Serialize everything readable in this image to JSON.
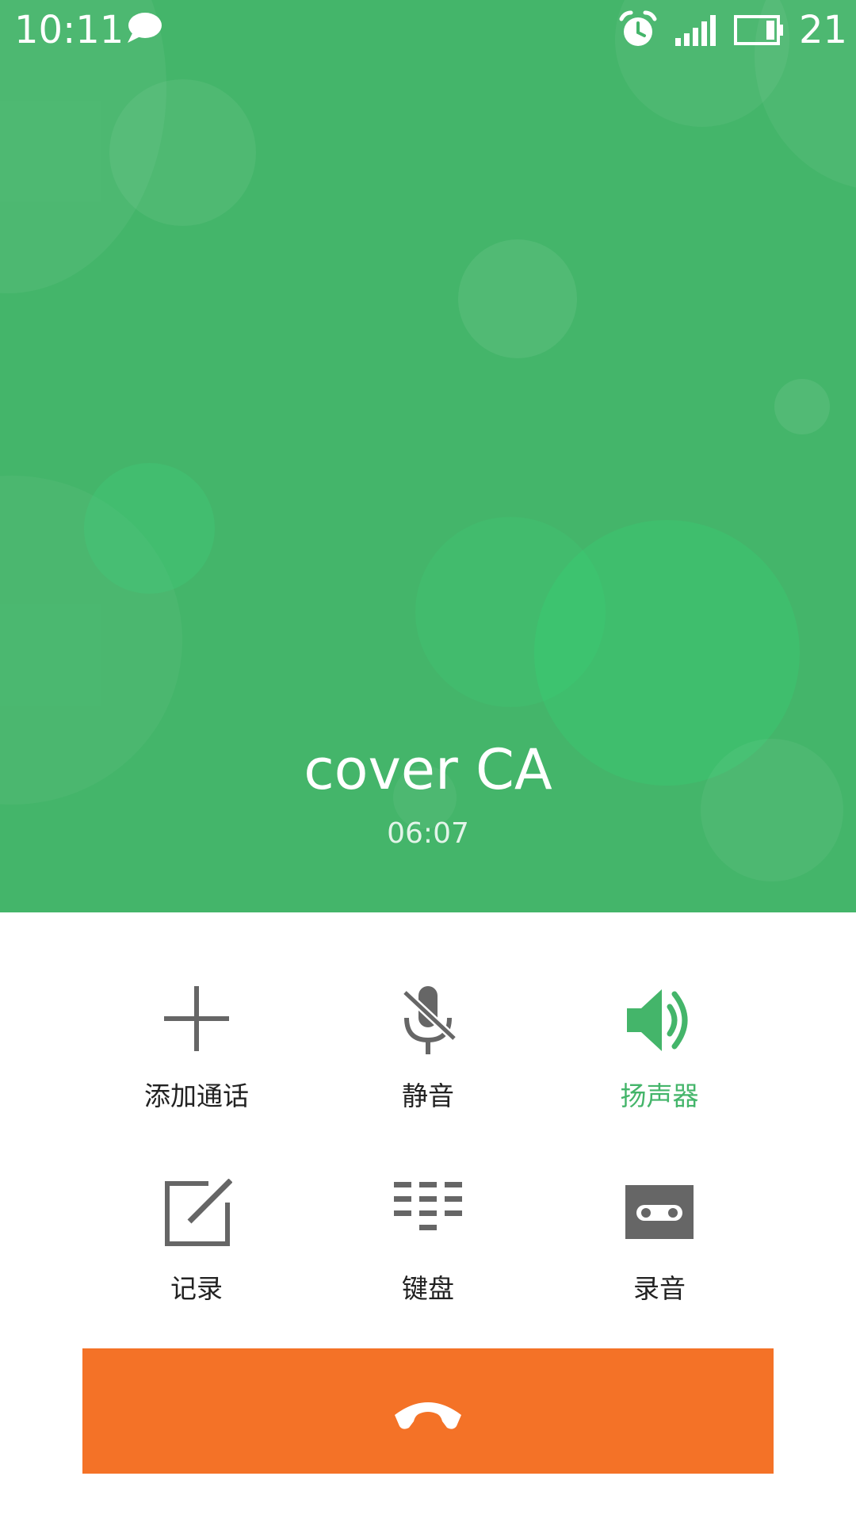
{
  "status_bar": {
    "time": "10:11",
    "battery_level": "21",
    "icons": [
      "message-icon",
      "alarm-icon",
      "signal-icon",
      "battery-icon"
    ]
  },
  "call": {
    "caller_name": "cover CA",
    "duration": "06:07"
  },
  "actions": [
    {
      "label": "添加通话",
      "icon": "plus-icon",
      "active": false
    },
    {
      "label": "静音",
      "icon": "mic-off-icon",
      "active": false
    },
    {
      "label": "扬声器",
      "icon": "speaker-icon",
      "active": true
    },
    {
      "label": "记录",
      "icon": "note-edit-icon",
      "active": false
    },
    {
      "label": "键盘",
      "icon": "dialpad-icon",
      "active": false
    },
    {
      "label": "录音",
      "icon": "record-icon",
      "active": false
    }
  ],
  "end_call": {
    "icon": "end-call-icon"
  },
  "colors": {
    "header_green": "#44b56a",
    "accent_green": "#44b56a",
    "end_call_orange": "#f47227",
    "icon_gray": "#666666"
  }
}
